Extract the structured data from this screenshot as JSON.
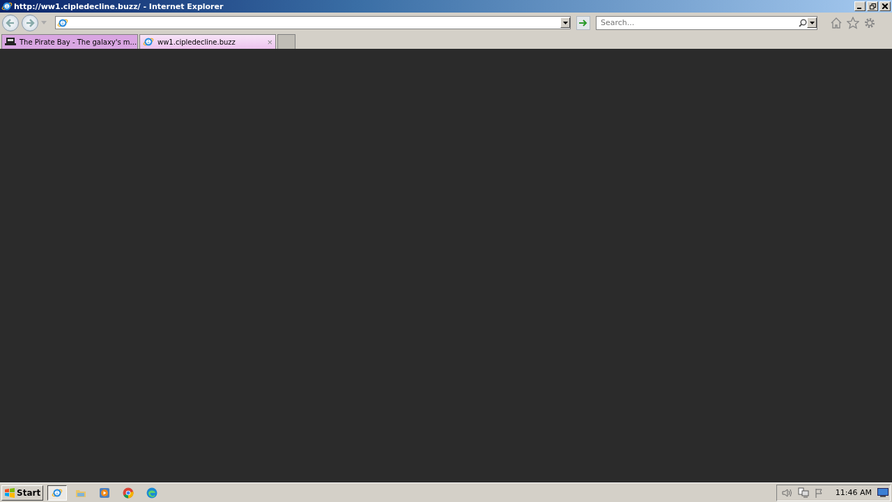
{
  "window": {
    "title": "http://ww1.cipledecline.buzz/ - Internet Explorer"
  },
  "search": {
    "placeholder": "Search..."
  },
  "tabs": [
    {
      "label": "The Pirate Bay - The galaxy's m...",
      "selected": false,
      "kind": "pirate"
    },
    {
      "label": "ww1.cipledecline.buzz",
      "selected": true,
      "kind": "ie",
      "close": "×"
    }
  ],
  "taskbar": {
    "start": "Start",
    "apps": [
      {
        "kind": "ie",
        "active": true
      },
      {
        "kind": "folder",
        "active": false
      },
      {
        "kind": "media",
        "active": false
      },
      {
        "kind": "chrome",
        "active": false
      },
      {
        "kind": "edge",
        "active": false
      }
    ],
    "clock": "11:46 AM"
  }
}
